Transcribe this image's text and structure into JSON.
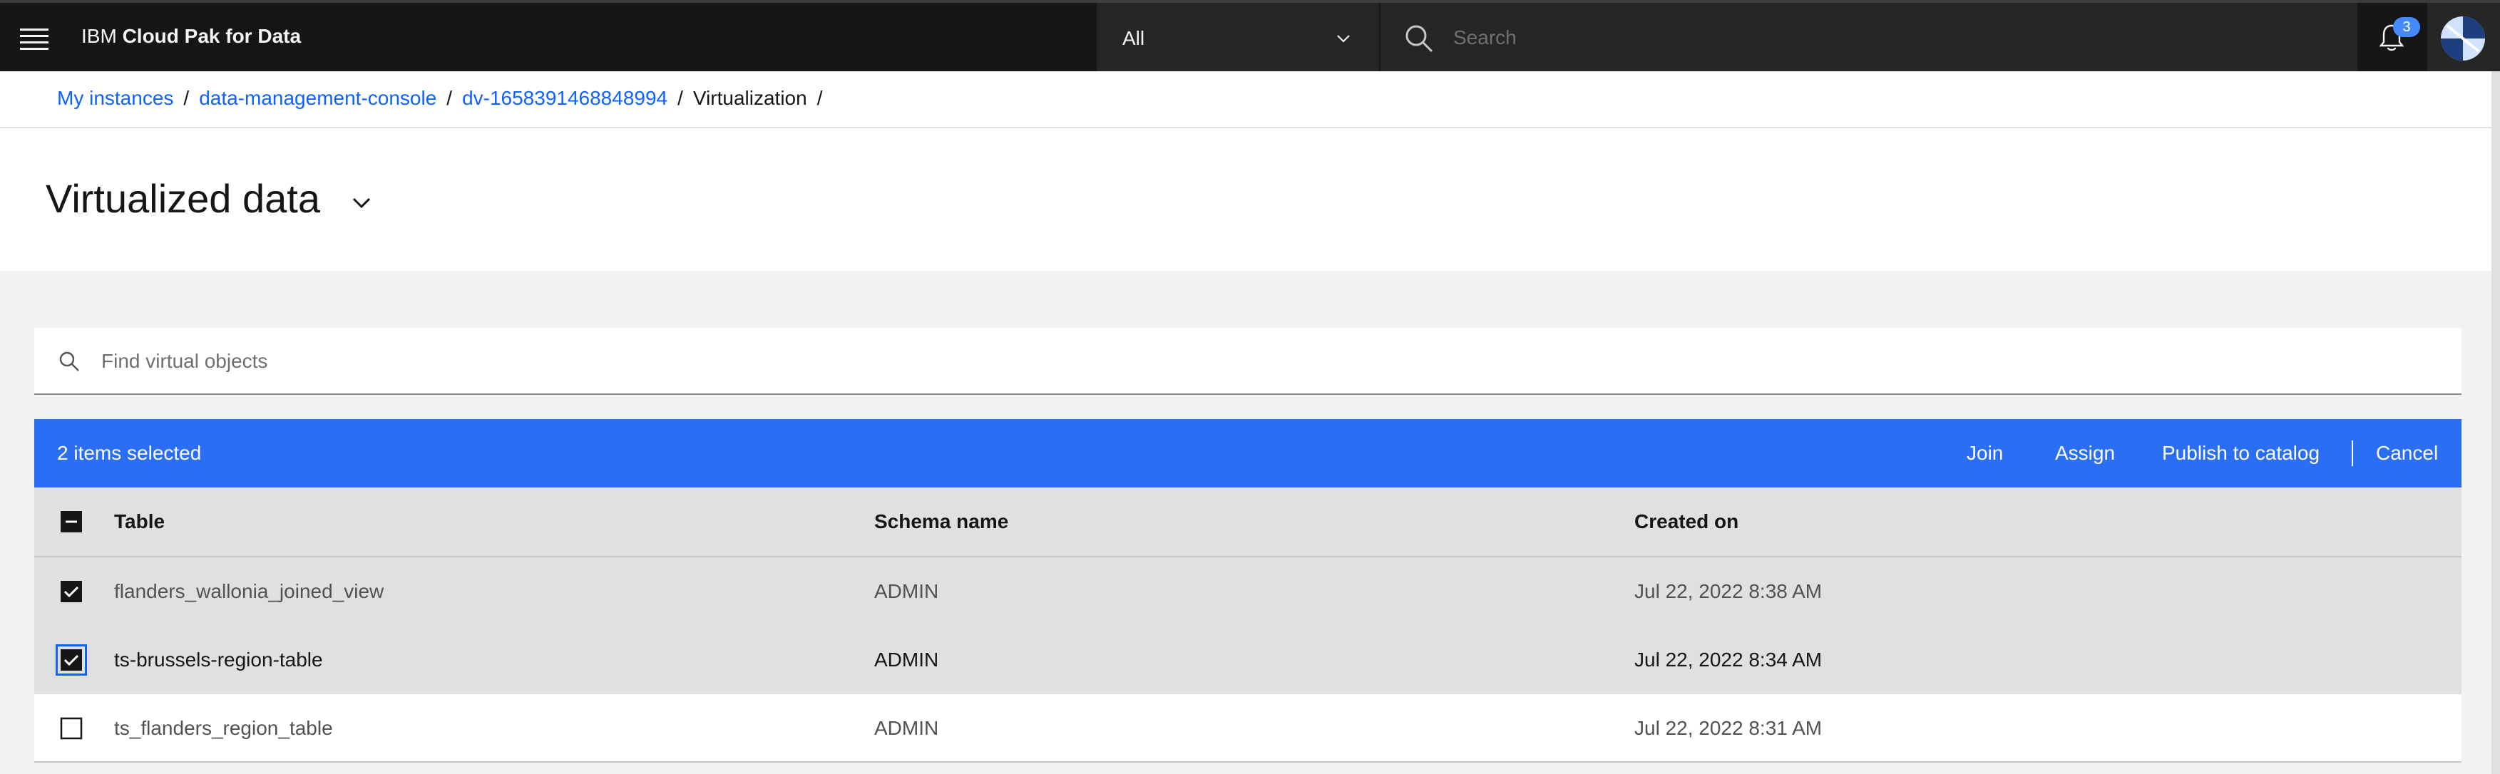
{
  "header": {
    "brand_prefix": "IBM",
    "brand_name": "Cloud Pak for Data",
    "scope_value": "All",
    "search_placeholder": "Search",
    "notification_count": "3"
  },
  "breadcrumb": {
    "items": [
      "My instances",
      "data-management-console",
      "dv-1658391468848994"
    ],
    "current": "Virtualization",
    "separator": "/"
  },
  "page": {
    "title": "Virtualized data"
  },
  "find": {
    "placeholder": "Find virtual objects"
  },
  "action_bar": {
    "selected_text": "2 items selected",
    "actions": [
      "Join",
      "Assign",
      "Publish to catalog"
    ],
    "cancel": "Cancel"
  },
  "table": {
    "columns": [
      "Table",
      "Schema name",
      "Created on"
    ],
    "rows": [
      {
        "table": "flanders_wallonia_joined_view",
        "schema": "ADMIN",
        "created": "Jul 22, 2022 8:38 AM",
        "checked": true
      },
      {
        "table": "ts-brussels-region-table",
        "schema": "ADMIN",
        "created": "Jul 22, 2022 8:34 AM",
        "checked": true
      },
      {
        "table": "ts_flanders_region_table",
        "schema": "ADMIN",
        "created": "Jul 22, 2022 8:31 AM",
        "checked": false
      }
    ]
  },
  "colors": {
    "header_bg": "#161616",
    "accent": "#0f62fe",
    "action_bar": "#2a6ff3",
    "selected_row": "#e0e0e0"
  }
}
